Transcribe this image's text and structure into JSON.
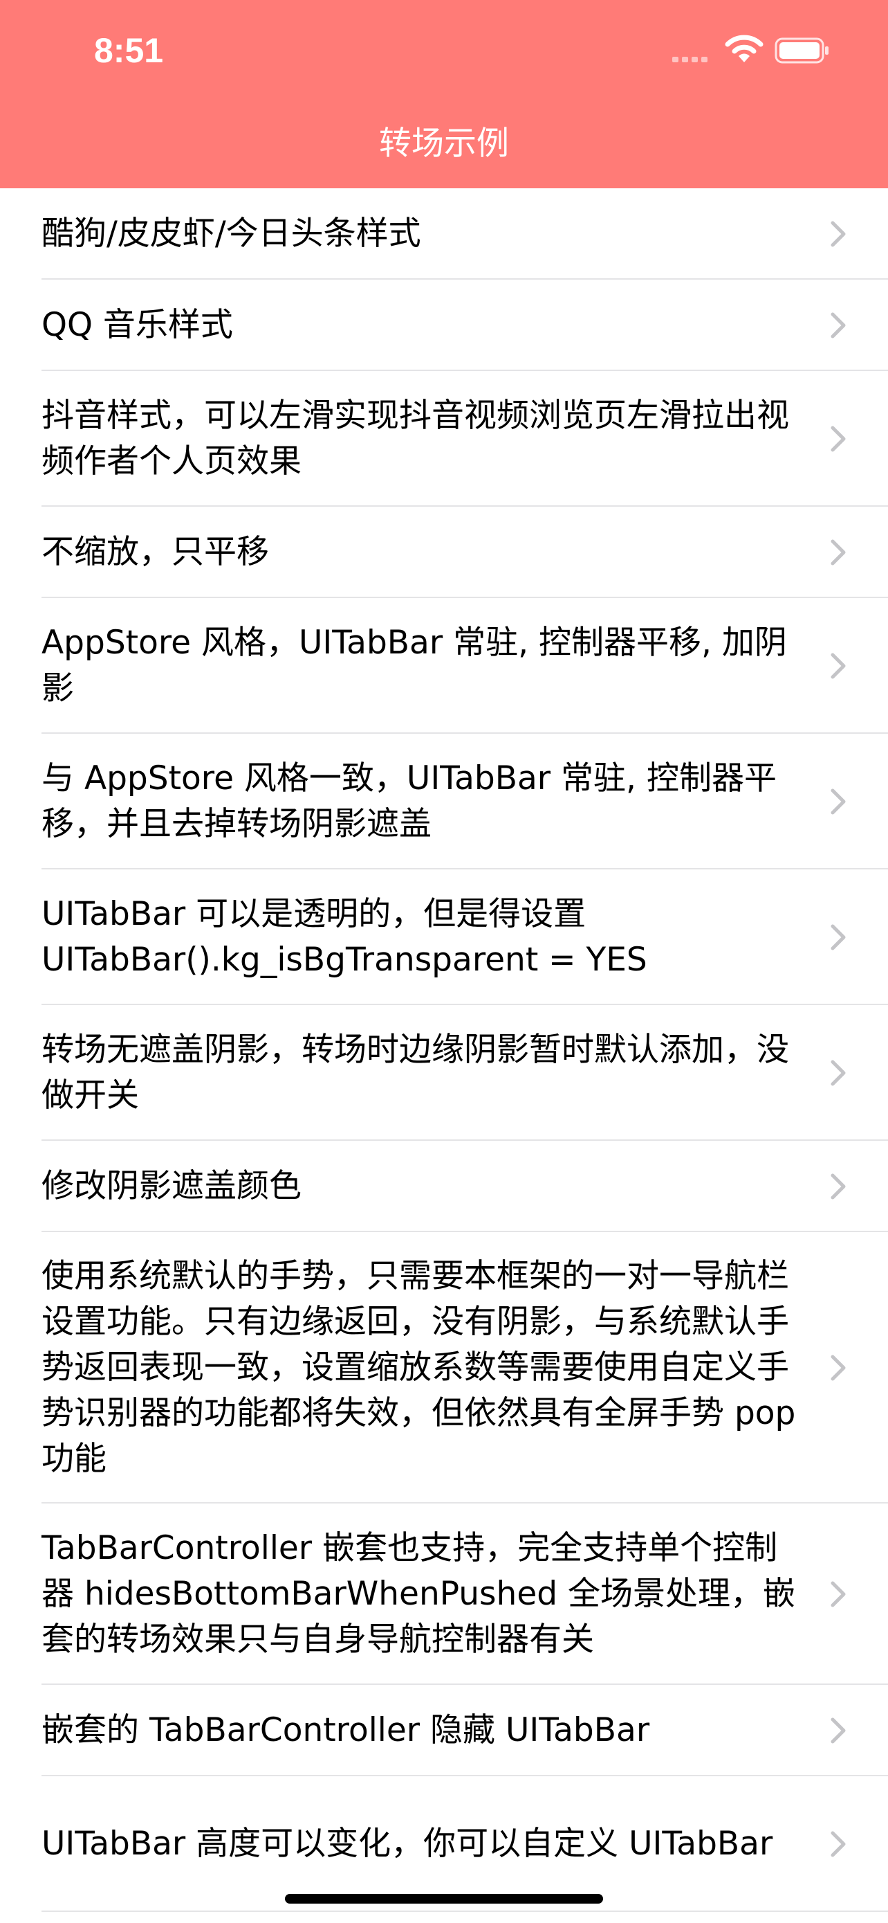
{
  "status_bar": {
    "time": "8:51"
  },
  "nav": {
    "title": "转场示例"
  },
  "list": {
    "items": [
      {
        "label": "酷狗/皮皮虾/今日头条样式"
      },
      {
        "label": "QQ 音乐样式"
      },
      {
        "label": "抖音样式，可以左滑实现抖音视频浏览页左滑拉出视频作者个人页效果"
      },
      {
        "label": "不缩放，只平移"
      },
      {
        "label": "AppStore 风格，UITabBar 常驻, 控制器平移, 加阴影"
      },
      {
        "label": "与 AppStore 风格一致，UITabBar 常驻, 控制器平移，并且去掉转场阴影遮盖"
      },
      {
        "label": "UITabBar 可以是透明的，但是得设置 UITabBar().kg_isBgTransparent = YES"
      },
      {
        "label": "转场无遮盖阴影，转场时边缘阴影暂时默认添加，没做开关"
      },
      {
        "label": "修改阴影遮盖颜色"
      },
      {
        "label": "使用系统默认的手势，只需要本框架的一对一导航栏设置功能。只有边缘返回，没有阴影，与系统默认手势返回表现一致，设置缩放系数等需要使用自定义手势识别器的功能都将失效，但依然具有全屏手势 pop 功能"
      },
      {
        "label": "TabBarController 嵌套也支持，完全支持单个控制器 hidesBottomBarWhenPushed 全场景处理，嵌套的转场效果只与自身导航控制器有关"
      },
      {
        "label": "嵌套的 TabBarController 隐藏 UITabBar"
      },
      {
        "label": "UITabBar 高度可以变化，你可以自定义 UITabBar"
      }
    ]
  },
  "colors": {
    "header_bg": "#ff7b77",
    "separator": "#e4e4e6",
    "chevron": "#c4c4c7"
  },
  "icons": [
    "signal-icon",
    "wifi-icon",
    "battery-icon",
    "chevron-right-icon"
  ]
}
